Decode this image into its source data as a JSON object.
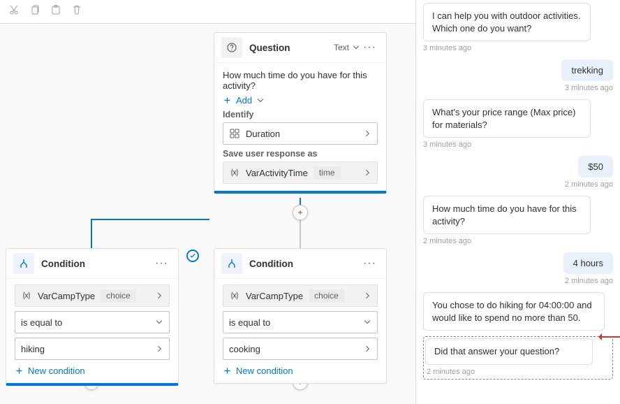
{
  "toolbar": {
    "cut": "Cut",
    "copy": "Copy",
    "paste": "Paste",
    "delete": "Delete"
  },
  "question_card": {
    "title": "Question",
    "type_label": "Text",
    "prompt": "How much time do you have for this activity?",
    "add_label": "Add",
    "identify_label": "Identify",
    "identify_value": "Duration",
    "save_label": "Save user response as",
    "var_name": "VarActivityTime",
    "var_type": "time"
  },
  "conditions": [
    {
      "title": "Condition",
      "var_name": "VarCampType",
      "var_type": "choice",
      "operator": "is equal to",
      "value": "hiking",
      "new_label": "New condition"
    },
    {
      "title": "Condition",
      "var_name": "VarCampType",
      "var_type": "choice",
      "operator": "is equal to",
      "value": "cooking",
      "new_label": "New condition"
    }
  ],
  "chat": {
    "m1": "I can help you with outdoor activities. Which one do you want?",
    "t1": "3 minutes ago",
    "u1": "trekking",
    "t2": "3 minutes ago",
    "m2": "What's your price range (Max price) for materials?",
    "t3": "3 minutes ago",
    "u2": "$50",
    "t4": "2 minutes ago",
    "m3": "How much time do you have for this activity?",
    "t5": "2 minutes ago",
    "u3": "4 hours",
    "t6": "2 minutes ago",
    "m4": "You chose to do hiking for 04:00:00 and would like to spend no more than 50.",
    "m5": "Did that answer your question?",
    "t7": "2 minutes ago"
  }
}
